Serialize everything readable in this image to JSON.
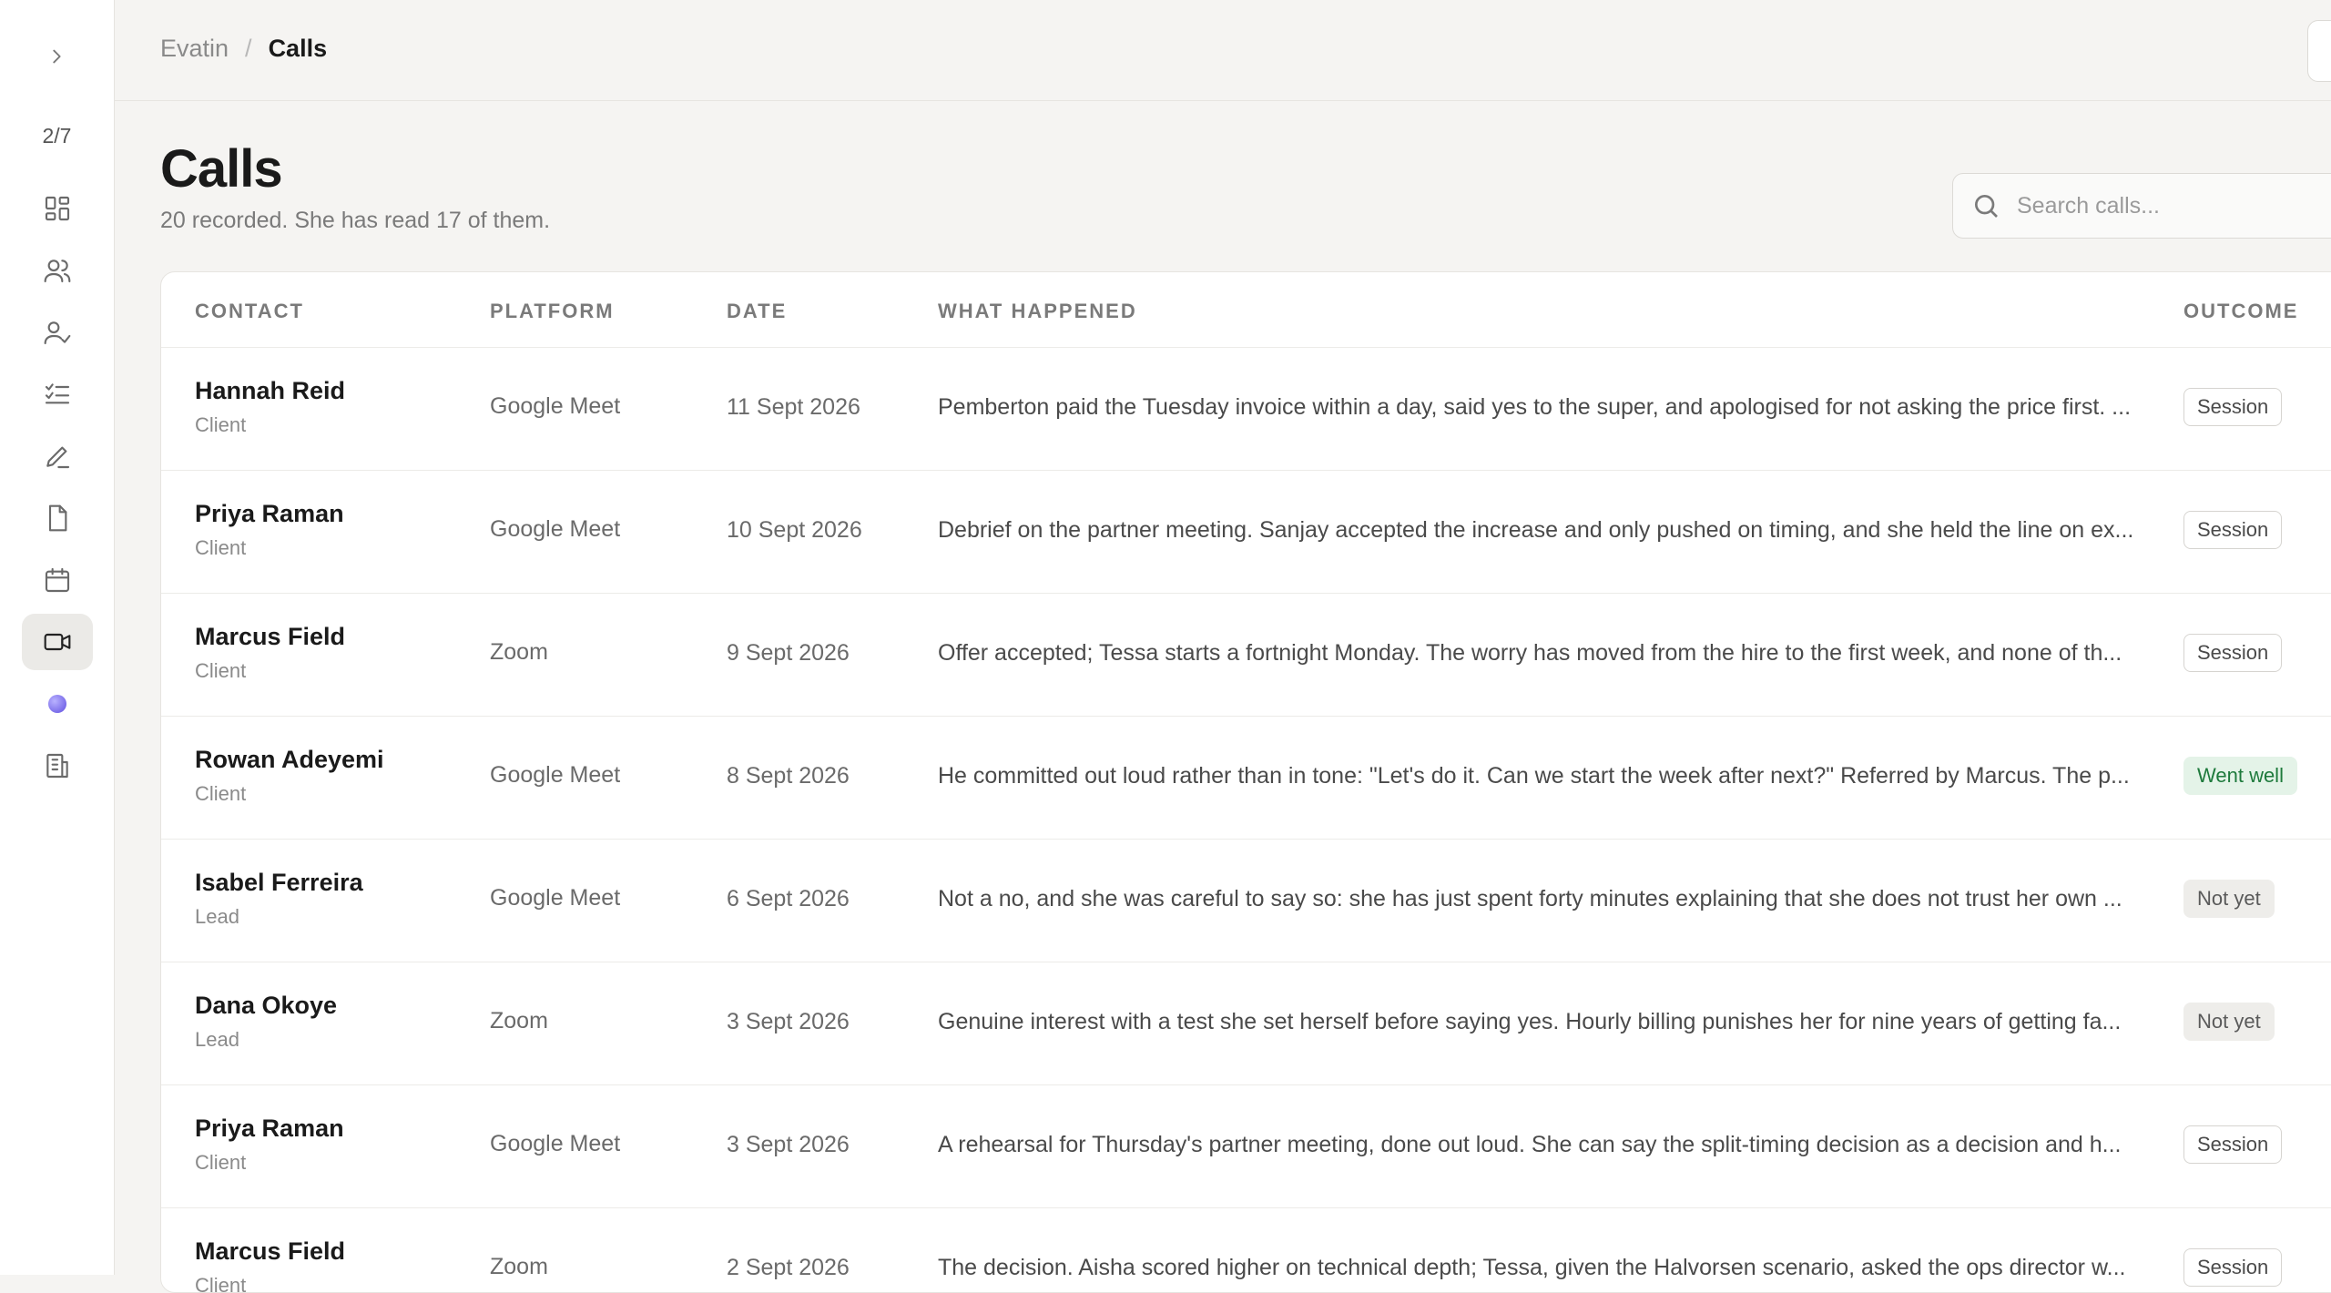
{
  "sidebar": {
    "counter": "2/7",
    "items": [
      {
        "icon": "dashboard-grid-icon"
      },
      {
        "icon": "people-icon"
      },
      {
        "icon": "user-check-icon"
      },
      {
        "icon": "checklist-icon"
      },
      {
        "icon": "pencil-icon"
      },
      {
        "icon": "document-icon"
      },
      {
        "icon": "calendar-icon"
      },
      {
        "icon": "video-camera-icon",
        "active": true
      },
      {
        "icon": "orb-icon"
      },
      {
        "icon": "building-icon"
      }
    ]
  },
  "breadcrumb": {
    "root": "Evatin",
    "separator": "/",
    "current": "Calls"
  },
  "page": {
    "title": "Calls",
    "subtitle": "20 recorded. She has read 17 of them."
  },
  "search": {
    "placeholder": "Search calls..."
  },
  "table": {
    "headers": {
      "contact": "CONTACT",
      "platform": "PLATFORM",
      "date": "DATE",
      "what": "WHAT HAPPENED",
      "outcome": "OUTCOME"
    },
    "rows": [
      {
        "name": "Hannah Reid",
        "role": "Client",
        "platform": "Google Meet",
        "date": "11 Sept 2026",
        "what": "Pemberton paid the Tuesday invoice within a day, said yes to the super, and apologised for not asking the price first. ...",
        "outcome": "Session"
      },
      {
        "name": "Priya Raman",
        "role": "Client",
        "platform": "Google Meet",
        "date": "10 Sept 2026",
        "what": "Debrief on the partner meeting. Sanjay accepted the increase and only pushed on timing, and she held the line on ex...",
        "outcome": "Session"
      },
      {
        "name": "Marcus Field",
        "role": "Client",
        "platform": "Zoom",
        "date": "9 Sept 2026",
        "what": "Offer accepted; Tessa starts a fortnight Monday. The worry has moved from the hire to the first week, and none of th...",
        "outcome": "Session"
      },
      {
        "name": "Rowan Adeyemi",
        "role": "Client",
        "platform": "Google Meet",
        "date": "8 Sept 2026",
        "what": "He committed out loud rather than in tone: \"Let's do it. Can we start the week after next?\" Referred by Marcus. The p...",
        "outcome": "Went well"
      },
      {
        "name": "Isabel Ferreira",
        "role": "Lead",
        "platform": "Google Meet",
        "date": "6 Sept 2026",
        "what": "Not a no, and she was careful to say so: she has just spent forty minutes explaining that she does not trust her own ...",
        "outcome": "Not yet"
      },
      {
        "name": "Dana Okoye",
        "role": "Lead",
        "platform": "Zoom",
        "date": "3 Sept 2026",
        "what": "Genuine interest with a test she set herself before saying yes. Hourly billing punishes her for nine years of getting fa...",
        "outcome": "Not yet"
      },
      {
        "name": "Priya Raman",
        "role": "Client",
        "platform": "Google Meet",
        "date": "3 Sept 2026",
        "what": "A rehearsal for Thursday's partner meeting, done out loud. She can say the split-timing decision as a decision and h...",
        "outcome": "Session"
      },
      {
        "name": "Marcus Field",
        "role": "Client",
        "platform": "Zoom",
        "date": "2 Sept 2026",
        "what": "The decision. Aisha scored higher on technical depth; Tessa, given the Halvorsen scenario, asked the ops director w...",
        "outcome": "Session"
      }
    ]
  }
}
